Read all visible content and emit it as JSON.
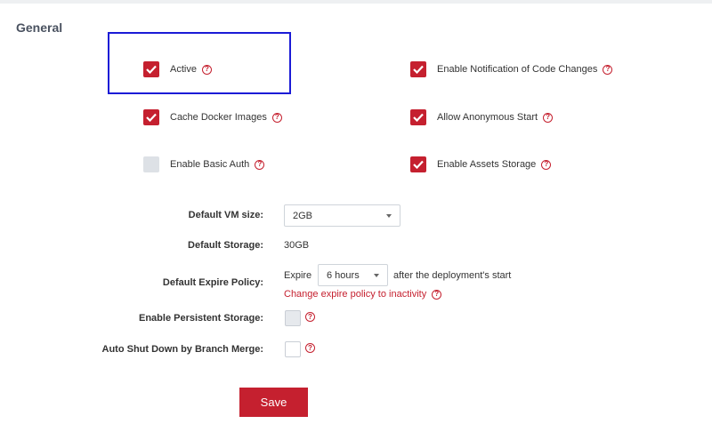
{
  "section": {
    "title": "General"
  },
  "checkboxes": [
    {
      "label": "Active",
      "checked": true
    },
    {
      "label": "Enable Notification of Code Changes",
      "checked": true
    },
    {
      "label": "Cache Docker Images",
      "checked": true
    },
    {
      "label": "Allow Anonymous Start",
      "checked": true
    },
    {
      "label": "Enable Basic Auth",
      "checked": false
    },
    {
      "label": "Enable Assets Storage",
      "checked": true
    }
  ],
  "help_symbol": "?",
  "vm_size": {
    "label": "Default VM size:",
    "value": "2GB"
  },
  "storage": {
    "label": "Default Storage:",
    "value": "30GB"
  },
  "expire": {
    "label": "Default Expire Policy:",
    "prefix": "Expire",
    "value": "6 hours",
    "suffix": "after the deployment's start",
    "link": "Change expire policy to inactivity"
  },
  "persistent_storage": {
    "label": "Enable Persistent Storage:",
    "checked": false
  },
  "auto_shutdown": {
    "label": "Auto Shut Down by Branch Merge:",
    "checked": false
  },
  "save_button": {
    "label": "Save"
  },
  "colors": {
    "accent": "#c5202f",
    "highlight_border": "#1b1bd6"
  }
}
